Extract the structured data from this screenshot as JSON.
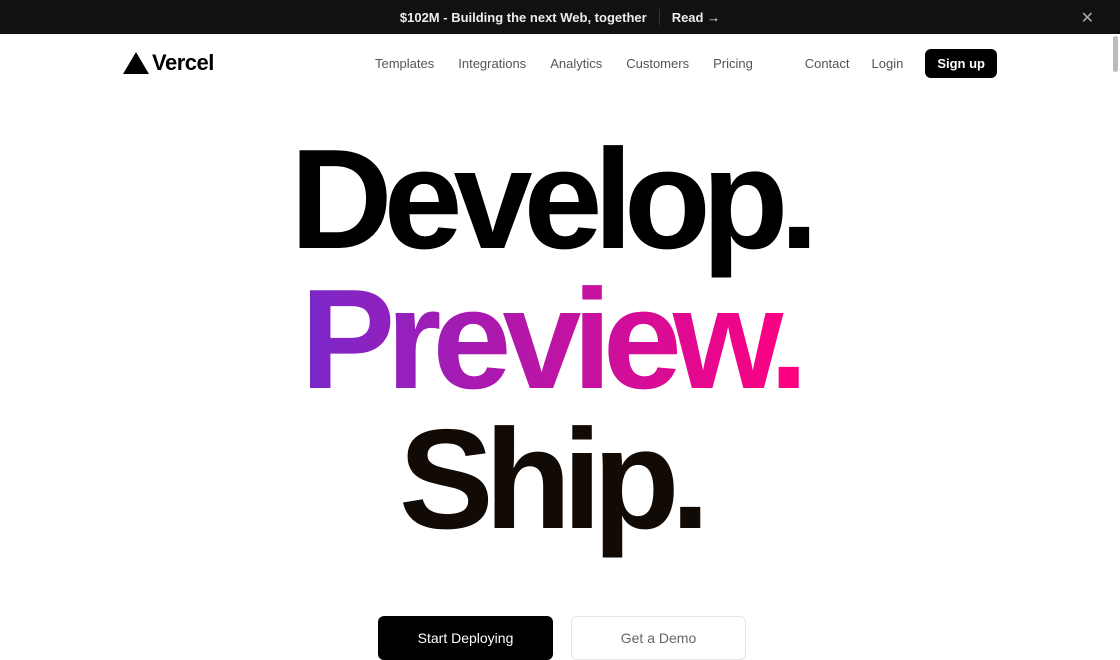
{
  "banner": {
    "text": "$102M - Building the next Web, together",
    "link": "Read →",
    "close": "✕"
  },
  "nav": {
    "brand": "Vercel",
    "links": [
      "Templates",
      "Integrations",
      "Analytics",
      "Customers",
      "Pricing"
    ],
    "contact": "Contact",
    "login": "Login",
    "signup": "Sign up"
  },
  "hero": {
    "line1": "Develop.",
    "line2": "Preview.",
    "line3": "Ship.",
    "gradient": [
      "#7928ca",
      "#ff0080"
    ]
  },
  "cta": {
    "primary": "Start Deploying",
    "secondary": "Get a Demo"
  }
}
